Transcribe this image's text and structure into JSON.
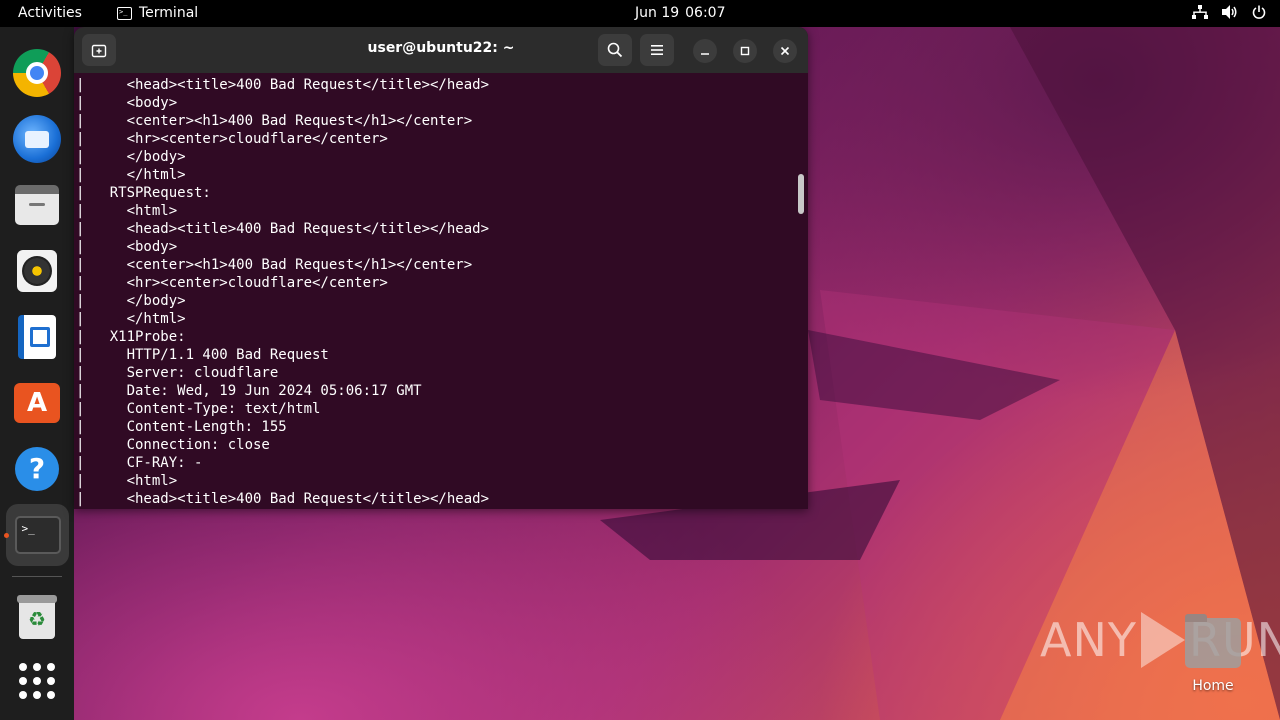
{
  "topbar": {
    "activities": "Activities",
    "app_name": "Terminal",
    "date": "Jun 19",
    "time": "06:07",
    "tray_icons": [
      "network-icon",
      "volume-icon",
      "power-icon"
    ]
  },
  "dock": {
    "items": [
      {
        "name": "chrome",
        "icon": "chrome-icon"
      },
      {
        "name": "thunderbird",
        "icon": "thunderbird-icon"
      },
      {
        "name": "files",
        "icon": "files-icon"
      },
      {
        "name": "rhythmbox",
        "icon": "rhythmbox-icon"
      },
      {
        "name": "libreoffice-writer",
        "icon": "writer-icon"
      },
      {
        "name": "app-center",
        "icon": "app-center-icon",
        "glyph": "A"
      },
      {
        "name": "help",
        "icon": "help-icon",
        "glyph": "?"
      },
      {
        "name": "terminal",
        "icon": "terminal-icon",
        "glyph": ">_",
        "running": true
      },
      {
        "name": "trash",
        "icon": "trash-icon",
        "glyph": "♻"
      },
      {
        "name": "show-apps",
        "icon": "apps-grid-icon"
      }
    ]
  },
  "terminal": {
    "title": "user@ubuntu22: ~",
    "lines": [
      "|     <head><title>400 Bad Request</title></head>",
      "|     <body>",
      "|     <center><h1>400 Bad Request</h1></center>",
      "|     <hr><center>cloudflare</center>",
      "|     </body>",
      "|     </html>",
      "|   RTSPRequest:",
      "|     <html>",
      "|     <head><title>400 Bad Request</title></head>",
      "|     <body>",
      "|     <center><h1>400 Bad Request</h1></center>",
      "|     <hr><center>cloudflare</center>",
      "|     </body>",
      "|     </html>",
      "|   X11Probe:",
      "|     HTTP/1.1 400 Bad Request",
      "|     Server: cloudflare",
      "|     Date: Wed, 19 Jun 2024 05:06:17 GMT",
      "|     Content-Type: text/html",
      "|     Content-Length: 155",
      "|     Connection: close",
      "|     CF-RAY: -",
      "|     <html>",
      "|     <head><title>400 Bad Request</title></head>"
    ]
  },
  "desktop": {
    "home_label": "Home",
    "watermark": {
      "left": "ANY",
      "right": "RUN"
    }
  },
  "colors": {
    "terminal_bg": "#300a24",
    "header_bg": "#2c2c2c",
    "accent": "#e95420"
  }
}
